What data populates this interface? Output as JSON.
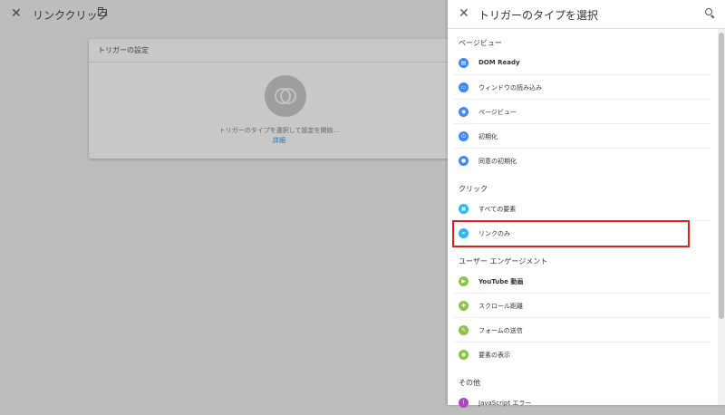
{
  "background": {
    "title": "リンククリック",
    "config_card": {
      "title": "トリガーの設定",
      "hint": "トリガーのタイプを選択して設定を開始...",
      "link": "詳細"
    }
  },
  "panel": {
    "title": "トリガーのタイプを選択",
    "sections": [
      {
        "header": "ページビュー",
        "items": [
          {
            "label": "DOM Ready",
            "icon": "document-icon",
            "color": "#4285f4",
            "bold": true
          },
          {
            "label": "ウィンドウの読み込み",
            "icon": "window-icon",
            "color": "#4285f4"
          },
          {
            "label": "ページビュー",
            "icon": "eye-icon",
            "color": "#4285f4"
          },
          {
            "label": "初期化",
            "icon": "power-icon",
            "color": "#4285f4"
          },
          {
            "label": "同意の初期化",
            "icon": "consent-icon",
            "color": "#4285f4"
          }
        ]
      },
      {
        "header": "クリック",
        "items": [
          {
            "label": "すべての要素",
            "icon": "cursor-icon",
            "color": "#29b6f6"
          },
          {
            "label": "リンクのみ",
            "icon": "link-icon",
            "color": "#29b6f6"
          }
        ]
      },
      {
        "header": "ユーザー エンゲージメント",
        "items": [
          {
            "label": "YouTube 動画",
            "icon": "play-icon",
            "color": "#8bc34a",
            "bold_prefix": "YouTube"
          },
          {
            "label": "スクロール距離",
            "icon": "scroll-icon",
            "color": "#8bc34a"
          },
          {
            "label": "フォームの送信",
            "icon": "form-icon",
            "color": "#8bc34a"
          },
          {
            "label": "要素の表示",
            "icon": "visibility-icon",
            "color": "#8bc34a"
          }
        ]
      },
      {
        "header": "その他",
        "items": [
          {
            "label": "JavaScript エラー",
            "icon": "error-icon",
            "color": "#ab47bc"
          }
        ]
      }
    ]
  },
  "highlight_color": "#e11d1d"
}
